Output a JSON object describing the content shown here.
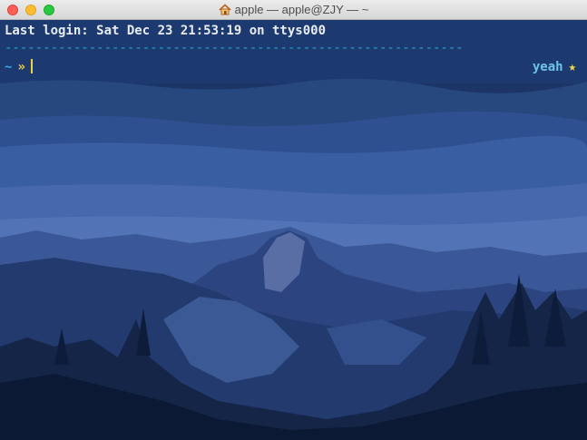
{
  "window": {
    "title": "apple — apple@ZJY — ~",
    "icon": "home-icon"
  },
  "terminal": {
    "last_login": "Last login: Sat Dec 23 21:53:19 on ttys000",
    "separator": "------------------------------------------------------------",
    "prompt": {
      "dir": "~",
      "arrow": "»",
      "right_user": "yeah",
      "right_symbol": "★"
    }
  },
  "colors": {
    "background": "#1d3566",
    "prompt_dir": "#37a9e6",
    "prompt_arrow": "#f0d23c",
    "separator": "#2aa3d6"
  }
}
